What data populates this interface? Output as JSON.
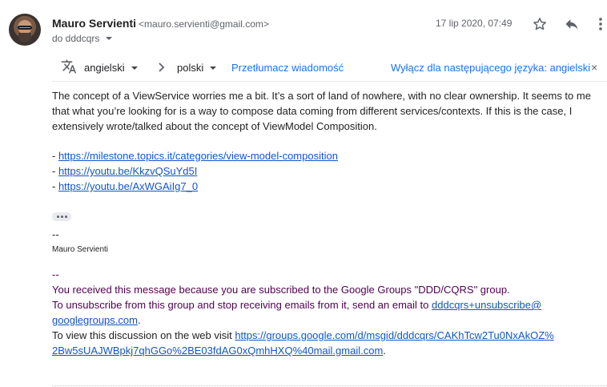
{
  "header": {
    "sender_name": "Mauro Servienti",
    "sender_email": "<mauro.servienti@gmail.com>",
    "to_label": "do dddcqrs",
    "date": "17 lip 2020, 07:49",
    "icons": [
      "star-icon",
      "reply-icon",
      "more-vert-icon"
    ]
  },
  "translate": {
    "from_lang": "angielski",
    "to_lang": "polski",
    "translate_link": "Przetłumacz wiadomość",
    "disable_link": "Wyłącz dla następującego języka: angielski",
    "close": "×"
  },
  "body": {
    "paragraph": "The concept of a ViewService worries me a bit. It’s a sort of land of nowhere, with no clear ownership. It seems to me that what you’re looking for is a way to compose data coming from different services/contexts. If this is the case, I extensively wrote/talked about the concept of ViewModel Composition.",
    "links": [
      {
        "prefix": "- ",
        "url": "https://milestone.topics.it/categories/view-model-composition"
      },
      {
        "prefix": "- ",
        "url": "https://youtu.be/KkzvQSuYd5I"
      },
      {
        "prefix": "- ",
        "url": "https://youtu.be/AxWGAiIg7_0"
      }
    ]
  },
  "signature": {
    "dash": "--",
    "name": "Mauro Servienti"
  },
  "footer": {
    "dash": "--",
    "line1": "You received this message because you are subscribed to the Google Groups \"DDD/CQRS\" group.",
    "line2_prefix": "To unsubscribe from this group and stop receiving emails from it, send an email to ",
    "unsubscribe_email_1": "dddcqrs+unsubscribe@",
    "unsubscribe_email_2": "googlegroups.com",
    "line2_suffix": ".",
    "line3_prefix": "To view this discussion on the web visit ",
    "web_url_1": "https://groups.google.com/d/msgid/dddcqrs/CAKhTcw2Tu0NxAkOZ%",
    "web_url_2": "2Bw5sUAJWBpkj7qhGGo%2BE03fdAG0xQmhHXQ%40mail.gmail.com",
    "line3_suffix": "."
  }
}
